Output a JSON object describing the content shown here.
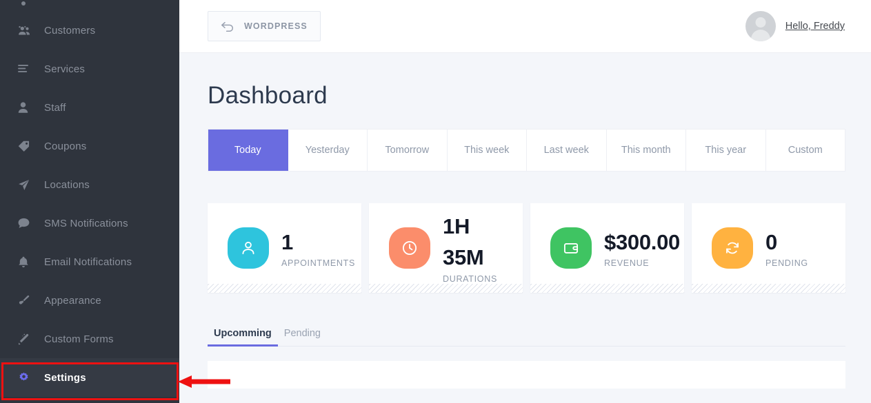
{
  "sidebar": {
    "items": [
      {
        "label": "",
        "icon": "partial-item-icon",
        "active": false,
        "partial": true
      },
      {
        "label": "Customers",
        "icon": "users-icon",
        "active": false
      },
      {
        "label": "Services",
        "icon": "list-icon",
        "active": false
      },
      {
        "label": "Staff",
        "icon": "person-icon",
        "active": false
      },
      {
        "label": "Coupons",
        "icon": "tag-icon",
        "active": false
      },
      {
        "label": "Locations",
        "icon": "paper-plane-icon",
        "active": false
      },
      {
        "label": "SMS Notifications",
        "icon": "chat-bubble-icon",
        "active": false
      },
      {
        "label": "Email Notifications",
        "icon": "bell-icon",
        "active": false
      },
      {
        "label": "Appearance",
        "icon": "paintbrush-icon",
        "active": false
      },
      {
        "label": "Custom Forms",
        "icon": "magic-wand-icon",
        "active": false
      },
      {
        "label": "Settings",
        "icon": "gear-icon",
        "active": true
      }
    ]
  },
  "topbar": {
    "wordpress_label": "WORDPRESS",
    "wordpress_icon": "back-arrow-icon",
    "greeting": "Hello, Freddy"
  },
  "page": {
    "title": "Dashboard"
  },
  "range_tabs": [
    {
      "label": "Today",
      "active": true
    },
    {
      "label": "Yesterday",
      "active": false
    },
    {
      "label": "Tomorrow",
      "active": false
    },
    {
      "label": "This week",
      "active": false
    },
    {
      "label": "Last week",
      "active": false
    },
    {
      "label": "This month",
      "active": false
    },
    {
      "label": "This year",
      "active": false
    },
    {
      "label": "Custom",
      "active": false
    }
  ],
  "stats": [
    {
      "value": "1",
      "label": "APPOINTMENTS",
      "icon": "person-icon",
      "color": "#2ec4dd"
    },
    {
      "value": "1H 35M",
      "label": "DURATIONS",
      "icon": "clock-icon",
      "color": "#fb8d6b"
    },
    {
      "value": "$300.00",
      "label": "REVENUE",
      "icon": "wallet-icon",
      "color": "#3fc462"
    },
    {
      "value": "0",
      "label": "PENDING",
      "icon": "sync-icon",
      "color": "#ffb240"
    }
  ],
  "lower_tabs": [
    {
      "label": "Upcomming",
      "active": true
    },
    {
      "label": "Pending",
      "active": false
    }
  ],
  "annotation": {
    "highlight_color": "#ee1111",
    "arrow_color": "#ee1111",
    "target": "Settings"
  },
  "colors": {
    "accent": "#6a6ce0",
    "sidebar_bg": "#2f343d",
    "sidebar_active_bg": "#353a44",
    "page_bg": "#f4f6fa"
  }
}
